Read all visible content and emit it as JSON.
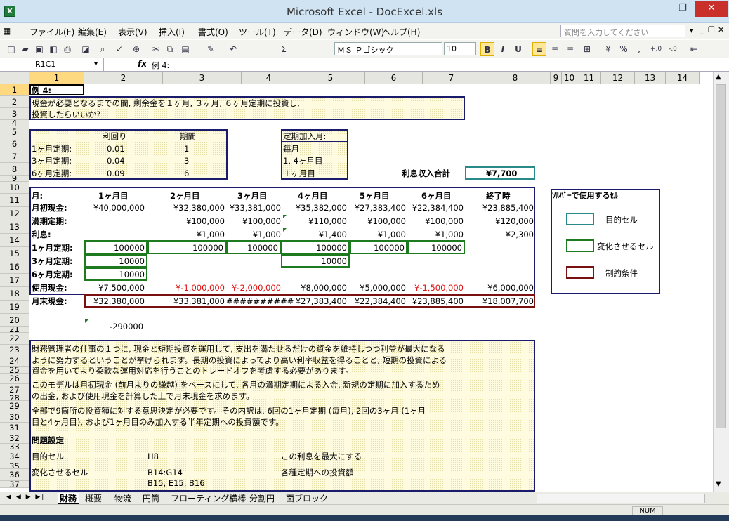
{
  "window": {
    "title": "Microsoft Excel - DocExcel.xls",
    "minimize": "–",
    "restore": "❐",
    "close": "✕"
  },
  "menu": [
    "ファイル(F)",
    "編集(E)",
    "表示(V)",
    "挿入(I)",
    "書式(O)",
    "ツール(T)",
    "データ(D)",
    "ウィンドウ(W)",
    "ヘルプ(H)"
  ],
  "help_placeholder": "質問を入力してください",
  "toolbar": {
    "font": "ＭＳ Ｐゴシック",
    "size": "10",
    "bold": "B",
    "italic": "I",
    "underline": "U",
    "sigma": "Σ",
    "percent": "%",
    "comma": ","
  },
  "formula": {
    "namebox": "R1C1",
    "fx": "fx",
    "content": "例 4:"
  },
  "columns": [
    "1",
    "2",
    "3",
    "4",
    "5",
    "6",
    "7",
    "8",
    "9",
    "10",
    "11",
    "12",
    "13",
    "14"
  ],
  "rows": [
    "1",
    "2",
    "3",
    "4",
    "5",
    "6",
    "7",
    "8",
    "9",
    "10",
    "11",
    "12",
    "13",
    "14",
    "15",
    "16",
    "17",
    "18",
    "19",
    "20",
    "21",
    "22",
    "23",
    "24",
    "25",
    "26",
    "27",
    "28",
    "29",
    "30",
    "31",
    "32",
    "33",
    "34",
    "35",
    "36",
    "37"
  ],
  "sheet": {
    "title": "例 4:",
    "intro1": "現金が必要となるまでの間, 剰余金を１ヶ月, ３ヶ月, ６ヶ月定期に投資し,",
    "intro2": "投資したらいいか?",
    "rate_header": "利回り",
    "period_header": "期間",
    "terms": [
      {
        "label": "1ヶ月定期:",
        "rate": "0.01",
        "period": "1"
      },
      {
        "label": "3ヶ月定期:",
        "rate": "0.04",
        "period": "3"
      },
      {
        "label": "6ヶ月定期:",
        "rate": "0.09",
        "period": "6"
      }
    ],
    "join_title": "定期加入月:",
    "join_rows": [
      "毎月",
      "1, 4ヶ月目",
      "１ヶ月目"
    ],
    "interest_label": "利息収入合計",
    "interest_value": "¥7,700",
    "month_label": "月:",
    "months": [
      "1ヶ月目",
      "2ヶ月目",
      "3ヶ月目",
      "4ヶ月目",
      "5ヶ月目",
      "6ヶ月目",
      "終了時"
    ],
    "row_labels": {
      "start": "月初現金:",
      "maturity": "満期定期:",
      "interest": "利息:",
      "t1": "1ヶ月定期:",
      "t3": "3ヶ月定期:",
      "t6": "6ヶ月定期:",
      "use": "使用現金:",
      "end": "月末現金:"
    },
    "start_cash": [
      "¥40,000,000",
      "¥32,380,000",
      "¥33,381,000",
      "¥35,382,000",
      "¥27,383,400",
      "¥22,384,400",
      "¥23,885,400"
    ],
    "maturity": [
      "",
      "¥100,000",
      "¥100,000",
      "¥110,000",
      "¥100,000",
      "¥100,000",
      "¥120,000"
    ],
    "interest": [
      "",
      "¥1,000",
      "¥1,000",
      "¥1,400",
      "¥1,000",
      "¥1,000",
      "¥2,300"
    ],
    "t1": [
      "100000",
      "100000",
      "100000",
      "100000",
      "100000",
      "100000"
    ],
    "t3_m1": "10000",
    "t3_m4": "10000",
    "t6_m1": "10000",
    "use_cash": [
      "¥7,500,000",
      "¥-1,000,000",
      "¥-2,000,000",
      "¥8,000,000",
      "¥5,000,000",
      "¥-1,500,000",
      "¥6,000,000"
    ],
    "end_cash": [
      "¥32,380,000",
      "¥33,381,000",
      "##########",
      "¥27,383,400",
      "¥22,384,400",
      "¥23,885,400",
      "¥18,007,700"
    ],
    "r20": "-290000",
    "solver_title": "ｿﾙﾊﾞｰで使用するｾﾙ",
    "legend": [
      "目的セル",
      "変化させるセル",
      "制約条件"
    ],
    "para": [
      "財務管理者の仕事の１つに, 現金と短期投資を運用して, 支出を満たせるだけの資金を維持しつつ利益が最大になる",
      "ように努力するということが挙げられます。長期の投資によってより高い利率収益を得ることと, 短期の投資による",
      "資金を用いてより柔軟な運用対応を行うことのトレードオフを考慮する必要があります。",
      "このモデルは月初現金 (前月よりの繰越) をベースにして, 各月の満期定期による入金, 新規の定期に加入するため",
      "の出金, および使用現金を計算した上で月末現金を求めます。",
      "全部で9箇所の投資額に対する意思決定が必要です。その内訳は, 6回の1ヶ月定期 (毎月), 2回の3ヶ月 (1ヶ月",
      "目と4ヶ月目), および1ヶ月目のみ加入する半年定期への投資額です。"
    ],
    "problem_title": "問題設定",
    "target_label": "目的セル",
    "target_cell": "H8",
    "target_desc": "この利息を最大にする",
    "change_label": "変化させるセル",
    "change_cells1": "B14:G14",
    "change_cells2": "B15, E15, B16",
    "change_desc": "各種定期への投資額"
  },
  "tabs": [
    "財務",
    "概要",
    "物流",
    "円筒",
    "フローティング横棒",
    "分割円",
    "面ブロック"
  ],
  "status": {
    "num": "NUM"
  },
  "colors": {
    "navy": "#1b1b6b",
    "green": "#1e7a1e",
    "teal": "#2a8a8a",
    "maroon": "#7a1010",
    "red": "#e01010"
  }
}
